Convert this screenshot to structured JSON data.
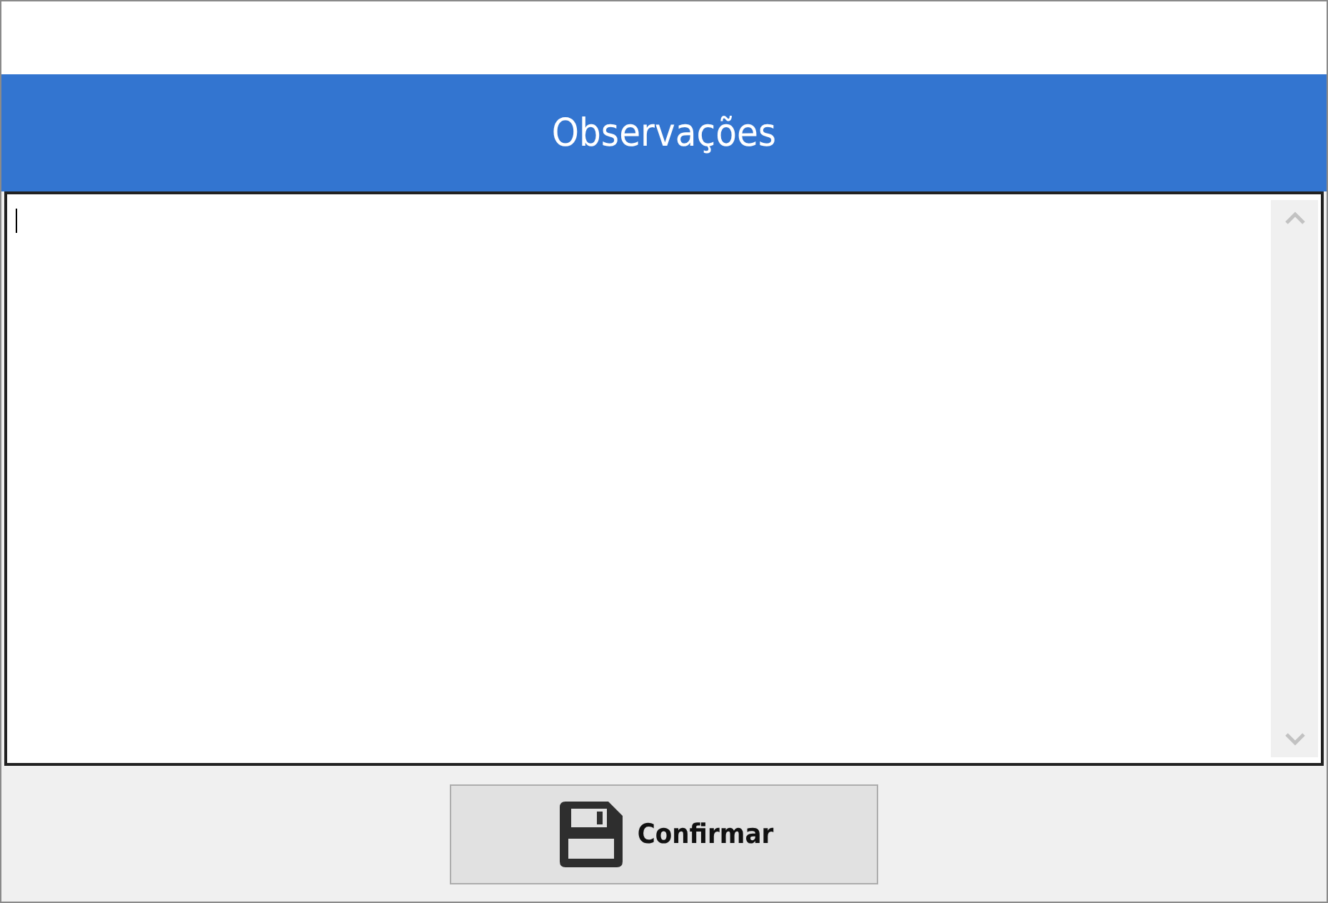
{
  "header": {
    "title": "Observações"
  },
  "notes": {
    "focused": true
  },
  "confirm_button": {
    "label": "Confirmar"
  }
}
